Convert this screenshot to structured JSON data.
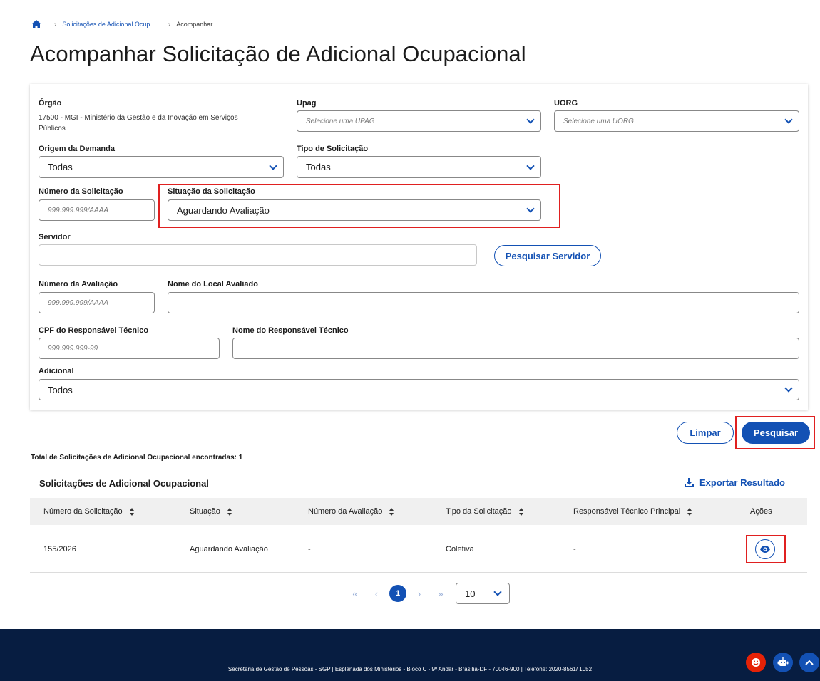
{
  "breadcrumb": {
    "link": "Solicitações de Adicional Ocup...",
    "current": "Acompanhar"
  },
  "page": {
    "title": "Acompanhar Solicitação de Adicional Ocupacional"
  },
  "form": {
    "orgao": {
      "label": "Órgão",
      "value": "17500 - MGI - Ministério da Gestão e da Inovação em Serviços Públicos"
    },
    "upag": {
      "label": "Upag",
      "placeholder": "Selecione uma UPAG"
    },
    "uorg": {
      "label": "UORG",
      "placeholder": "Selecione uma UORG"
    },
    "origem": {
      "label": "Origem da Demanda",
      "value": "Todas"
    },
    "tipo": {
      "label": "Tipo de Solicitação",
      "value": "Todas"
    },
    "numero_solicitacao": {
      "label": "Número da Solicitação",
      "placeholder": "999.999.999/AAAA"
    },
    "situacao": {
      "label": "Situação da Solicitação",
      "value": "Aguardando Avaliação"
    },
    "servidor": {
      "label": "Servidor",
      "value": "",
      "button": "Pesquisar Servidor"
    },
    "numero_avaliacao": {
      "label": "Número da Avaliação",
      "placeholder": "999.999.999/AAAA"
    },
    "local": {
      "label": "Nome do Local Avaliado",
      "value": ""
    },
    "cpf": {
      "label": "CPF do Responsável Técnico",
      "placeholder": "999.999.999-99"
    },
    "nome_resp": {
      "label": "Nome do Responsável Técnico",
      "value": ""
    },
    "adicional": {
      "label": "Adicional",
      "value": "Todos"
    }
  },
  "actions": {
    "clear": "Limpar",
    "search": "Pesquisar"
  },
  "results": {
    "total": "Total de Solicitações de Adicional Ocupacional encontradas: 1",
    "title": "Solicitações de Adicional Ocupacional",
    "export": "Exportar Resultado",
    "columns": [
      "Número da Solicitação",
      "Situação",
      "Número da Avaliação",
      "Tipo da Solicitação",
      "Responsável Técnico Principal",
      "Ações"
    ],
    "rows": [
      {
        "numero": "155/2026",
        "situacao": "Aguardando Avaliação",
        "avaliacao": "-",
        "tipo": "Coletiva",
        "responsavel": "-"
      }
    ]
  },
  "pagination": {
    "current": "1",
    "first": "«",
    "prev": "‹",
    "next": "›",
    "last": "»",
    "page_size": "10"
  },
  "footer": {
    "text": "Secretaria de Gestão de Pessoas - SGP | Esplanada dos Ministérios - Bloco C - 9º Andar - Brasília-DF - 70046-900 | Telefone: 2020-8561/ 1052"
  },
  "icons": {
    "home": "home-icon",
    "chevron": "chevron-down-icon",
    "sort": "sort-icon",
    "eye": "eye-icon",
    "download": "download-icon",
    "smile": "smile-icon",
    "robot": "robot-icon",
    "up": "arrow-up-icon"
  },
  "colors": {
    "primary": "#1351b4",
    "footer": "#071d41",
    "highlight": "#e02020",
    "fab_red": "#e52207"
  }
}
